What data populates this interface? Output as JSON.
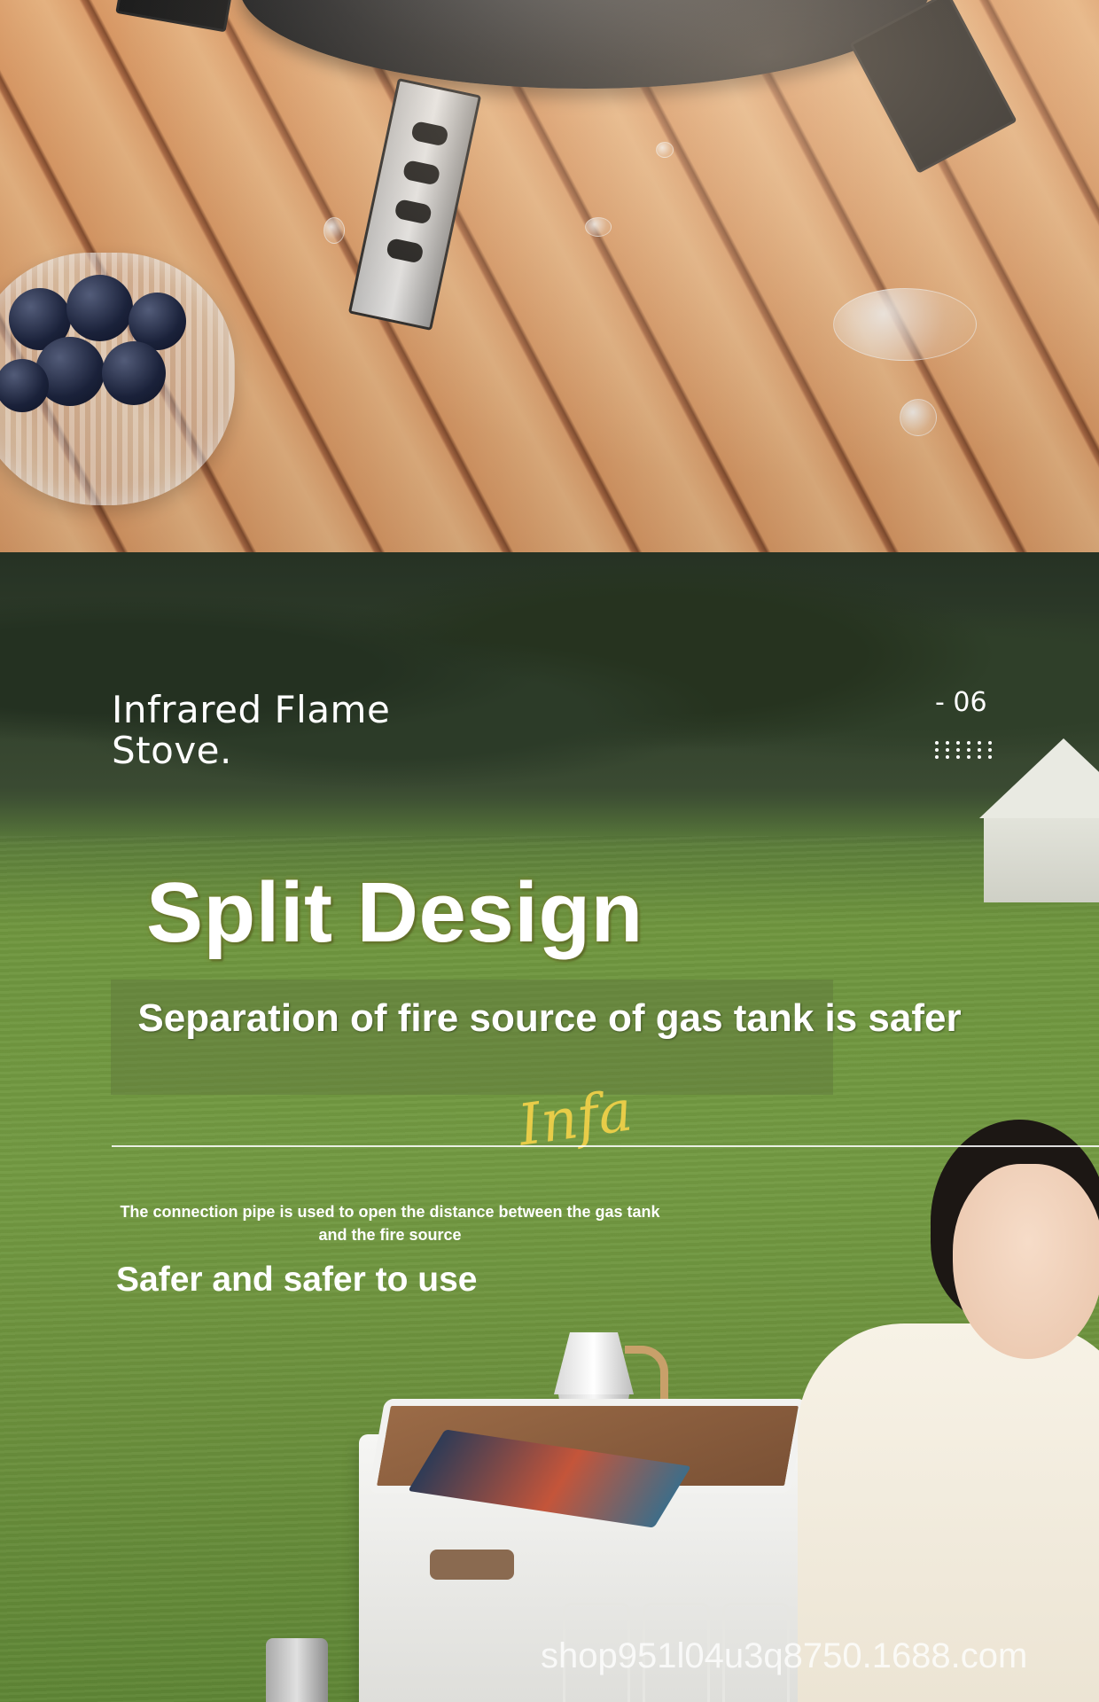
{
  "title": {
    "line1": "Infrared Flame",
    "line2": "Stove."
  },
  "page_number": "- 06",
  "headline": "Split Design",
  "subheadline": "Separation of fire source of gas tank is safer",
  "description": "The connection pipe is used to open the distance between the gas tank and the fire source",
  "tagline": "Safer and safer to use",
  "watermark": "shop951l04u3q8750.1688.com",
  "colors": {
    "headline_glow": "#7d8a34",
    "signature": "#f5d34a",
    "text": "#ffffff"
  }
}
